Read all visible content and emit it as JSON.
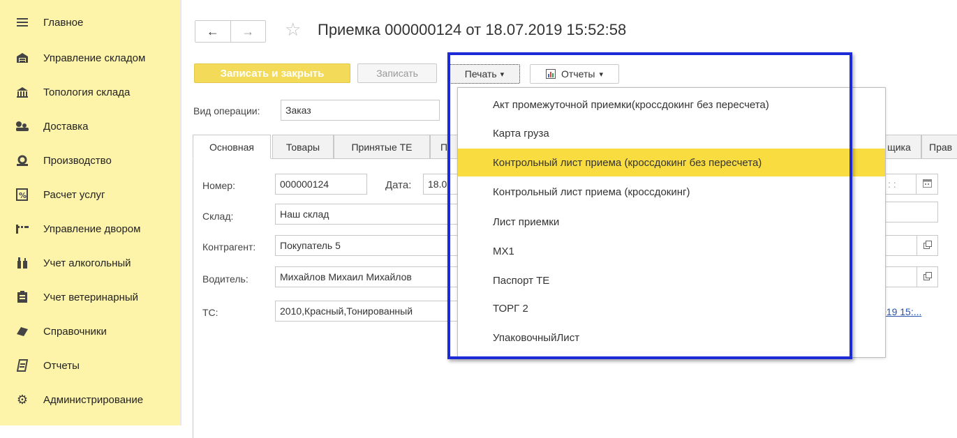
{
  "sidebar": {
    "items": [
      {
        "label": "Главное",
        "icon": "menu-lines-icon"
      },
      {
        "label": "Управление складом",
        "icon": "warehouse-icon"
      },
      {
        "label": "Топология склада",
        "icon": "building-icon"
      },
      {
        "label": "Доставка",
        "icon": "delivery-icon"
      },
      {
        "label": "Производство",
        "icon": "factory-icon"
      },
      {
        "label": "Расчет услуг",
        "icon": "percent-doc-icon"
      },
      {
        "label": "Управление двором",
        "icon": "barrier-icon"
      },
      {
        "label": "Учет алкогольный",
        "icon": "bottles-icon"
      },
      {
        "label": "Учет ветеринарный",
        "icon": "clipboard-icon"
      },
      {
        "label": "Справочники",
        "icon": "book-icon"
      },
      {
        "label": "Отчеты",
        "icon": "report-icon"
      },
      {
        "label": "Администрирование",
        "icon": "gear-icon"
      }
    ]
  },
  "header": {
    "back": "←",
    "forward": "→",
    "star": "☆",
    "title": "Приемка 000000124 от 18.07.2019 15:52:58"
  },
  "toolbar": {
    "save_close_label": "Записать и закрыть",
    "save_label": "Записать",
    "print_label": "Печать",
    "reports_label": "Отчеты",
    "dropdown_arrow": "▾"
  },
  "form": {
    "operation_label": "Вид операции:",
    "operation_value": "Заказ",
    "tabs": [
      "Основная",
      "Товары",
      "Принятые ТЕ",
      "П"
    ],
    "right_tabs": [
      "щика",
      "Прав"
    ],
    "number_label": "Номер:",
    "number_value": "000000124",
    "date_label": "Дата:",
    "date_value": "18.0",
    "warehouse_label": "Склад:",
    "warehouse_value": "Наш склад",
    "counterparty_label": "Контрагент:",
    "counterparty_value": "Покупатель 5",
    "driver_label": "Водитель:",
    "driver_value": "Михайлов Михаил Михайлов",
    "vehicle_label": "ТС:",
    "vehicle_value": "2010,Красный,Тонированный",
    "time_fragment": ":  :",
    "link_fragment": "019 15:..."
  },
  "print_menu": {
    "items": [
      "Акт промежуточной приемки(кроссдокинг без пересчета)",
      "Карта груза",
      "Контрольный лист приема (кроссдокинг без пересчета)",
      "Контрольный лист приема (кроссдокинг)",
      "Лист приемки",
      "МХ1",
      "Паспорт ТЕ",
      "ТОРГ 2",
      "УпаковочныйЛист"
    ],
    "highlighted_index": 2
  },
  "colors": {
    "sidebar_bg": "#fdf3a9",
    "primary_button": "#f3da58",
    "menu_highlight": "#f8dc40",
    "annotation_frame": "#1c2bd6",
    "link": "#2754a6"
  }
}
